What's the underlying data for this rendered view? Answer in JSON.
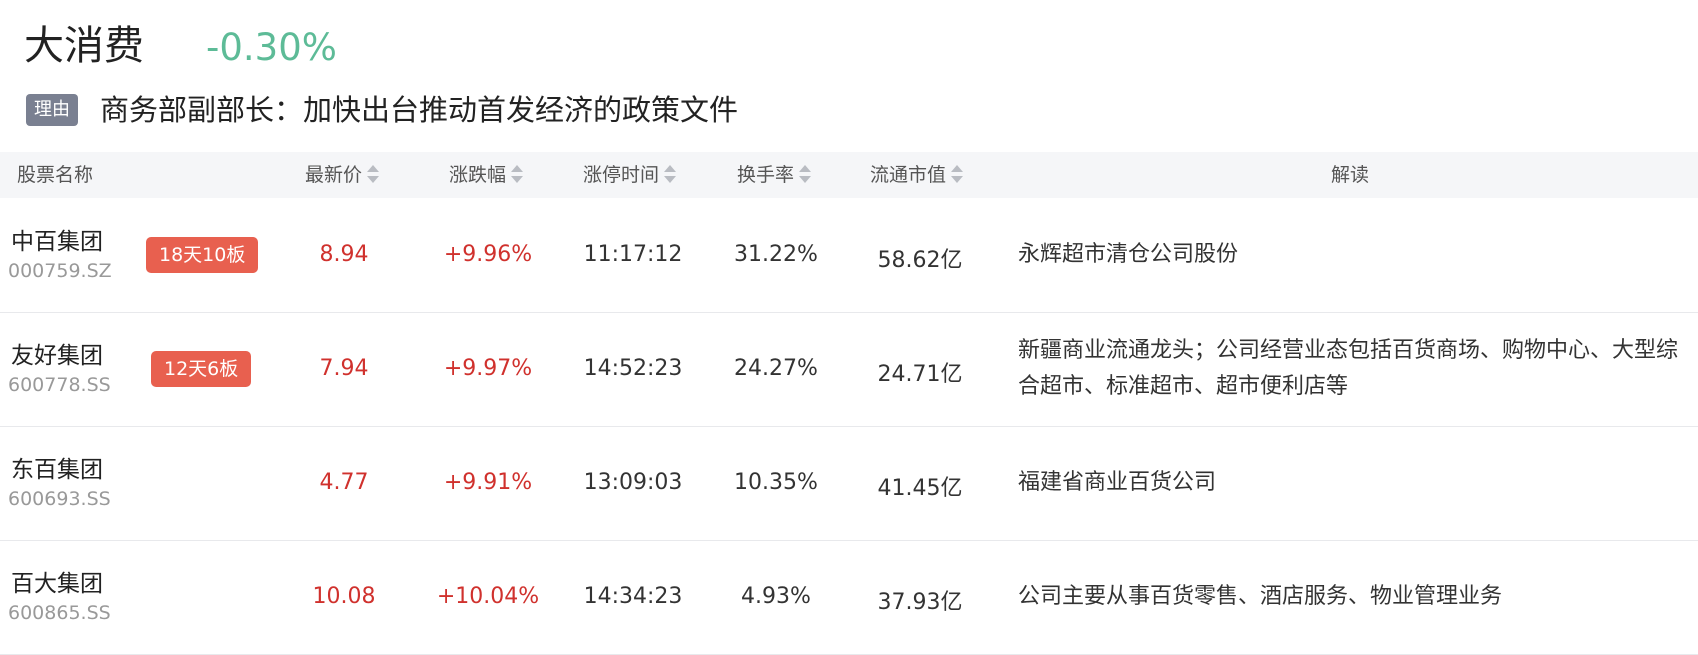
{
  "sector": {
    "name": "大消费",
    "change": "-0.30%",
    "reason_tag": "理由",
    "reason": "商务部副部长：加快出台推动首发经济的政策文件"
  },
  "columns": {
    "name": "股票名称",
    "price": "最新价",
    "change": "涨跌幅",
    "limit_time": "涨停时间",
    "turnover": "换手率",
    "market_cap": "流通市值",
    "interpretation": "解读"
  },
  "rows": [
    {
      "name": "中百集团",
      "code": "000759.SZ",
      "badge": "18天10板",
      "price": "8.94",
      "change": "+9.96%",
      "limit_time": "11:17:12",
      "turnover": "31.22%",
      "market_cap": "58.62亿",
      "interpretation": "永辉超市清仓公司股份"
    },
    {
      "name": "友好集团",
      "code": "600778.SS",
      "badge": "12天6板",
      "price": "7.94",
      "change": "+9.97%",
      "limit_time": "14:52:23",
      "turnover": "24.27%",
      "market_cap": "24.71亿",
      "interpretation": "新疆商业流通龙头；公司经营业态包括百货商场、购物中心、大型综合超市、标准超市、超市便利店等"
    },
    {
      "name": "东百集团",
      "code": "600693.SS",
      "badge": "",
      "price": "4.77",
      "change": "+9.91%",
      "limit_time": "13:09:03",
      "turnover": "10.35%",
      "market_cap": "41.45亿",
      "interpretation": "福建省商业百货公司"
    },
    {
      "name": "百大集团",
      "code": "600865.SS",
      "badge": "",
      "price": "10.08",
      "change": "+10.04%",
      "limit_time": "14:34:23",
      "turnover": "4.93%",
      "market_cap": "37.93亿",
      "interpretation": "公司主要从事百货零售、酒店服务、物业管理业务"
    }
  ]
}
